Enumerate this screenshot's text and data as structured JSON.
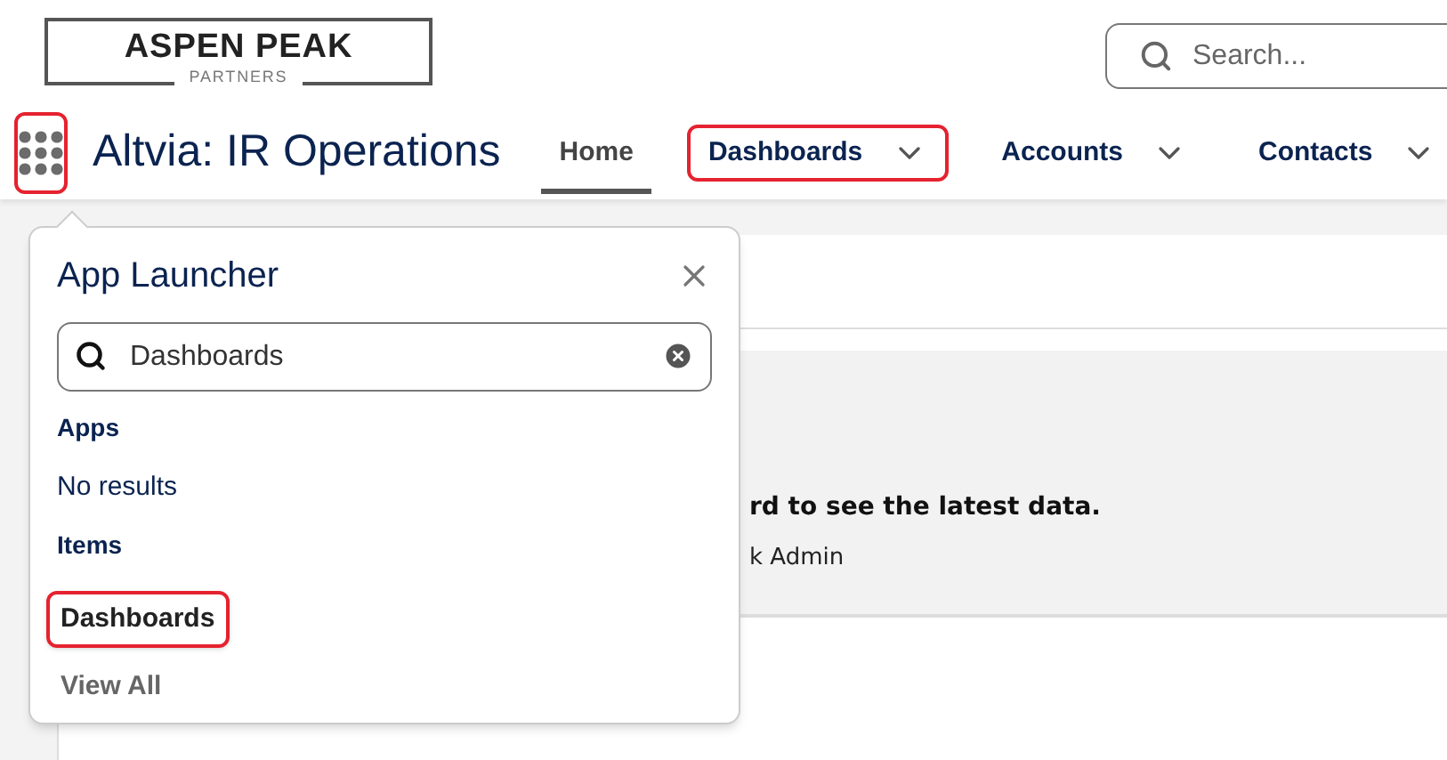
{
  "logo": {
    "name": "ASPEN PEAK",
    "tagline": "PARTNERS"
  },
  "search": {
    "placeholder": "Search..."
  },
  "app_launcher_button": {
    "highlighted": true
  },
  "app_title": "Altvia: IR Operations",
  "tabs": [
    {
      "label": "Home",
      "selected": true,
      "has_menu": false,
      "highlighted": false
    },
    {
      "label": "Dashboards",
      "selected": false,
      "has_menu": true,
      "highlighted": true
    },
    {
      "label": "Accounts",
      "selected": false,
      "has_menu": true,
      "highlighted": false
    },
    {
      "label": "Contacts",
      "selected": false,
      "has_menu": true,
      "highlighted": false
    }
  ],
  "banner": {
    "message": "rd to see the latest data.",
    "byline": "k Admin"
  },
  "app_launcher": {
    "title": "App Launcher",
    "search_value": "Dashboards",
    "sections": [
      {
        "heading": "Apps",
        "entries": [
          {
            "kind": "empty",
            "text": "No results",
            "highlighted": false
          }
        ]
      },
      {
        "heading": "Items",
        "entries": [
          {
            "kind": "item",
            "text": "Dashboards",
            "highlighted": true
          }
        ]
      }
    ],
    "view_all": "View All"
  }
}
